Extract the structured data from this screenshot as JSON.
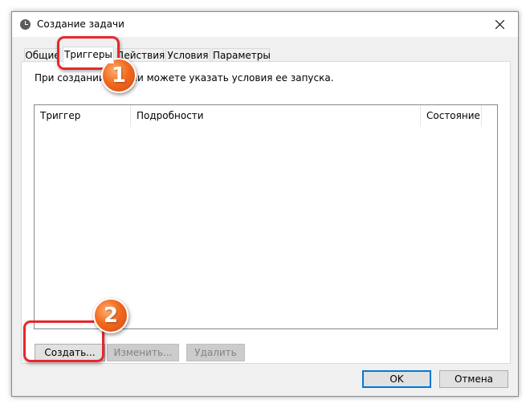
{
  "window": {
    "title": "Создание задачи",
    "title_icon": "clock-icon",
    "close_icon": "close-icon"
  },
  "tabs": [
    {
      "label": "Общие",
      "active": false
    },
    {
      "label": "Триггеры",
      "active": true
    },
    {
      "label": "Действия",
      "active": false
    },
    {
      "label": "Условия",
      "active": false
    },
    {
      "label": "Параметры",
      "active": false
    }
  ],
  "panel": {
    "info_text": "При создании задачи можете указать условия ее запуска."
  },
  "list": {
    "columns": [
      "Триггер",
      "Подробности",
      "Состояние"
    ],
    "rows": []
  },
  "actions": {
    "create": "Создать...",
    "edit": "Изменить...",
    "delete": "Удалить"
  },
  "dialog_buttons": {
    "ok": "OK",
    "cancel": "Отмена"
  },
  "annotations": {
    "step1": "1",
    "step2": "2",
    "color": "#e8272b",
    "badge_color": "#f26a1f"
  }
}
